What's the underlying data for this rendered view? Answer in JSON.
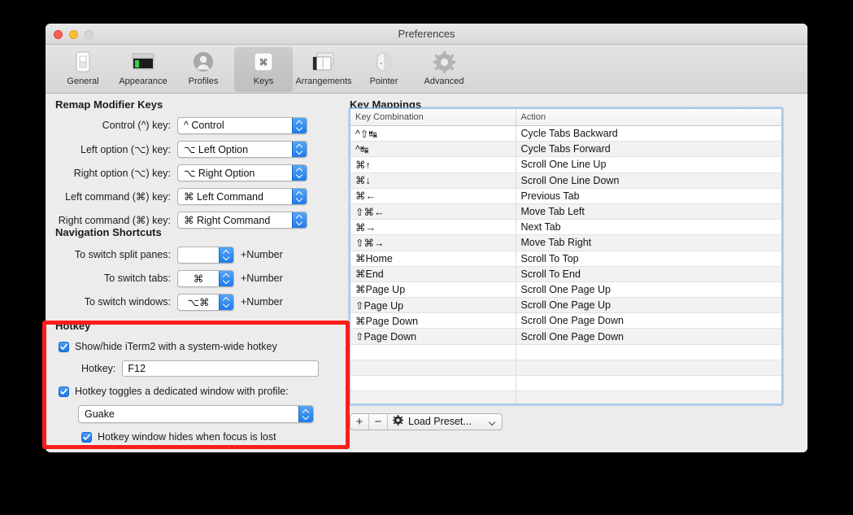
{
  "window": {
    "title": "Preferences",
    "traffic_lights": [
      "close-button",
      "minimize-button",
      "zoom-button"
    ]
  },
  "toolbar": {
    "items": [
      {
        "label": "General",
        "icon": "general-icon",
        "selected": false
      },
      {
        "label": "Appearance",
        "icon": "appearance-icon",
        "selected": false
      },
      {
        "label": "Profiles",
        "icon": "profiles-icon",
        "selected": false
      },
      {
        "label": "Keys",
        "icon": "keys-icon",
        "selected": true
      },
      {
        "label": "Arrangements",
        "icon": "arrangements-icon",
        "selected": false
      },
      {
        "label": "Pointer",
        "icon": "pointer-icon",
        "selected": false
      },
      {
        "label": "Advanced",
        "icon": "advanced-icon",
        "selected": false
      }
    ]
  },
  "remap_modifier_keys": {
    "title": "Remap Modifier Keys",
    "rows": [
      {
        "label": "Control (^) key:",
        "value": "^ Control"
      },
      {
        "label": "Left option (⌥) key:",
        "value": "⌥ Left Option"
      },
      {
        "label": "Right option (⌥) key:",
        "value": "⌥ Right Option"
      },
      {
        "label": "Left command (⌘) key:",
        "value": "⌘ Left Command"
      },
      {
        "label": "Right command (⌘) key:",
        "value": "⌘ Right Command"
      }
    ]
  },
  "navigation_shortcuts": {
    "title": "Navigation Shortcuts",
    "rows": [
      {
        "label": "To switch split panes:",
        "value": "",
        "suffix": "+Number"
      },
      {
        "label": "To switch tabs:",
        "value": "⌘",
        "suffix": "+Number"
      },
      {
        "label": "To switch windows:",
        "value": "⌥⌘",
        "suffix": "+Number"
      }
    ]
  },
  "hotkey": {
    "title": "Hotkey",
    "show_hide_label": "Show/hide iTerm2 with a system-wide hotkey",
    "show_hide_checked": true,
    "hotkey_field_label": "Hotkey:",
    "hotkey_field_value": "F12",
    "dedicated_label": "Hotkey toggles a dedicated window with profile:",
    "dedicated_checked": true,
    "profile_value": "Guake",
    "hides_focus_label": "Hotkey window hides when focus is lost",
    "hides_focus_checked": true,
    "annotation_color": "#fb1d1d"
  },
  "key_mappings": {
    "title": "Key Mappings",
    "columns": [
      "Key Combination",
      "Action"
    ],
    "rows": [
      {
        "combo": "^⇧↹",
        "action": "Cycle Tabs Backward"
      },
      {
        "combo": "^↹",
        "action": "Cycle Tabs Forward"
      },
      {
        "combo": "⌘↑",
        "action": "Scroll One Line Up"
      },
      {
        "combo": "⌘↓",
        "action": "Scroll One Line Down"
      },
      {
        "combo": "⌘←",
        "action": "Previous Tab"
      },
      {
        "combo": "⇧⌘←",
        "action": "Move Tab Left"
      },
      {
        "combo": "⌘→",
        "action": "Next Tab"
      },
      {
        "combo": "⇧⌘→",
        "action": "Move Tab Right"
      },
      {
        "combo": "⌘Home",
        "action": "Scroll To Top"
      },
      {
        "combo": "⌘End",
        "action": "Scroll To End"
      },
      {
        "combo": "⌘Page Up",
        "action": "Scroll One Page Up"
      },
      {
        "combo": "⇧Page Up",
        "action": "Scroll One Page Up"
      },
      {
        "combo": "⌘Page Down",
        "action": "Scroll One Page Down"
      },
      {
        "combo": "⇧Page Down",
        "action": "Scroll One Page Down"
      },
      {
        "combo": "",
        "action": ""
      },
      {
        "combo": "",
        "action": ""
      },
      {
        "combo": "",
        "action": ""
      },
      {
        "combo": "",
        "action": ""
      }
    ],
    "toolbar": {
      "add_label": "+",
      "remove_label": "−",
      "preset_label": "Load Preset...",
      "preset_icon": "gear-icon"
    }
  }
}
